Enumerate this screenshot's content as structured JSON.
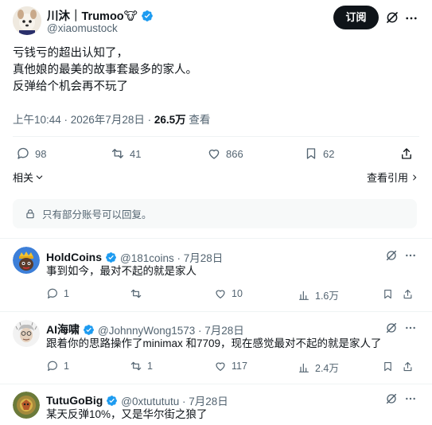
{
  "post": {
    "author_name": "川沐｜Trumoo🐮",
    "author_handle": "@xiaomustock",
    "subscribe_label": "订阅",
    "lines": [
      "亏钱亏的超出认知了，",
      "真他娘的最美的故事套最多的家人。",
      "反弹给个机会再不玩了"
    ],
    "timestamp": "上午10:44 · 2026年7月28日 · ",
    "views_count": "26.5万",
    "views_label": " 查看",
    "replies": "98",
    "reposts": "41",
    "likes": "866",
    "bookmarks": "62",
    "related_label": "相关",
    "quotes_label": "查看引用"
  },
  "notice": {
    "text": "只有部分账号可以回复。"
  },
  "replies": [
    {
      "name": "HoldCoins",
      "handle": "@181coins · 7月28日",
      "text": "事到如今，最对不起的就是家人",
      "replies": "1",
      "reposts": "",
      "likes": "10",
      "views": "1.6万"
    },
    {
      "name": "AI海啸",
      "handle": "@JohnnyWong1573 · 7月28日",
      "text": "跟着你的思路操作了minimax 和7709，现在感觉最对不起的就是家人了",
      "replies": "1",
      "reposts": "1",
      "likes": "117",
      "views": "2.4万"
    },
    {
      "name": "TutuGoBig",
      "handle": "@0xtutututu · 7月28日",
      "text": "某天反弹10%，又是华尔街之狼了"
    }
  ],
  "colors": {
    "verified": "#1d9bf0",
    "text_secondary": "#536471",
    "divider": "#eff3f4"
  }
}
